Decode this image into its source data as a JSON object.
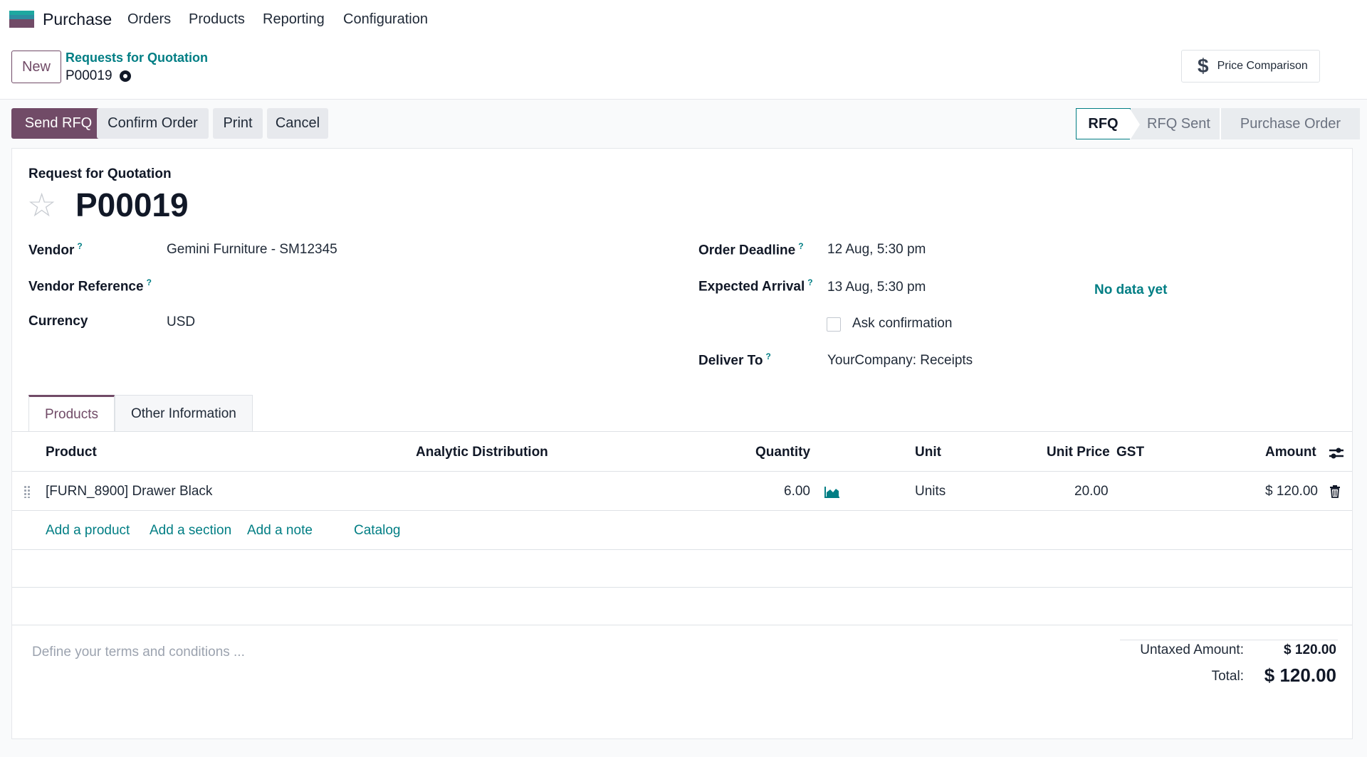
{
  "nav": {
    "app_name": "Purchase",
    "items": [
      "Orders",
      "Products",
      "Reporting",
      "Configuration"
    ]
  },
  "control": {
    "new_label": "New",
    "breadcrumb_parent": "Requests for Quotation",
    "record": "P00019",
    "price_comparison": "Price Comparison"
  },
  "actions": {
    "send_rfq": "Send RFQ",
    "confirm_order": "Confirm Order",
    "print": "Print",
    "cancel": "Cancel"
  },
  "status": {
    "stages": [
      "RFQ",
      "RFQ Sent",
      "Purchase Order"
    ],
    "active": "RFQ"
  },
  "form": {
    "subtitle": "Request for Quotation",
    "title": "P00019",
    "vendor_label": "Vendor",
    "vendor_value": "Gemini Furniture - SM12345",
    "vendor_ref_label": "Vendor Reference",
    "currency_label": "Currency",
    "currency_value": "USD",
    "order_deadline_label": "Order Deadline",
    "order_deadline_value": "12 Aug, 5:30 pm",
    "expected_arrival_label": "Expected Arrival",
    "expected_arrival_value": "13 Aug, 5:30 pm",
    "no_data": "No data yet",
    "ask_confirmation": "Ask confirmation",
    "deliver_to_label": "Deliver To",
    "deliver_to_value": "YourCompany: Receipts",
    "help_mark": "?"
  },
  "tabs": [
    "Products",
    "Other Information"
  ],
  "table": {
    "headers": {
      "product": "Product",
      "analytic": "Analytic Distribution",
      "quantity": "Quantity",
      "unit": "Unit",
      "unit_price": "Unit Price",
      "gst": "GST",
      "amount": "Amount"
    },
    "rows": [
      {
        "product": "[FURN_8900] Drawer Black",
        "quantity": "6.00",
        "unit": "Units",
        "unit_price": "20.00",
        "amount": "$ 120.00"
      }
    ],
    "add_links": [
      "Add a product",
      "Add a section",
      "Add a note",
      "Catalog"
    ]
  },
  "terms_placeholder": "Define your terms and conditions ...",
  "totals": {
    "untaxed_label": "Untaxed Amount:",
    "untaxed_value": "$ 120.00",
    "total_label": "Total:",
    "total_value": "$ 120.00"
  },
  "icons": {
    "settings": "gear-icon",
    "favorite": "star-icon",
    "forecast": "area-chart-icon",
    "delete": "trash-icon",
    "columns": "sliders-icon",
    "drag": "drag-handle-icon"
  },
  "colors": {
    "brand": "#714b67",
    "link": "#017e84"
  }
}
